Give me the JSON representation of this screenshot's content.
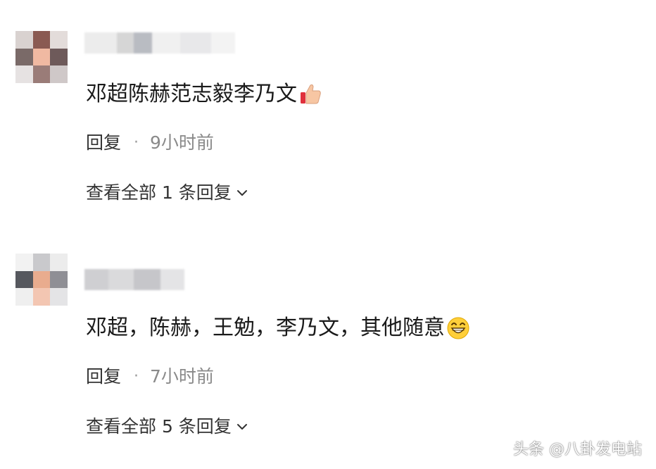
{
  "comments": [
    {
      "text": "邓超陈赫范志毅李乃文",
      "emoji": "thumbs-up-icon",
      "reply_label": "回复",
      "separator": "·",
      "time": "9小时前",
      "view_all_label": "查看全部 1 条回复"
    },
    {
      "text": "邓超，陈赫，王勉，李乃文，其他随意",
      "emoji": "grinning-face-icon",
      "reply_label": "回复",
      "separator": "·",
      "time": "7小时前",
      "view_all_label": "查看全部 5 条回复"
    }
  ],
  "watermark": "头条 @八卦发电站",
  "colors": {
    "text_primary": "#1a1a1a",
    "text_secondary": "#8a8a8a",
    "background": "#ffffff"
  }
}
